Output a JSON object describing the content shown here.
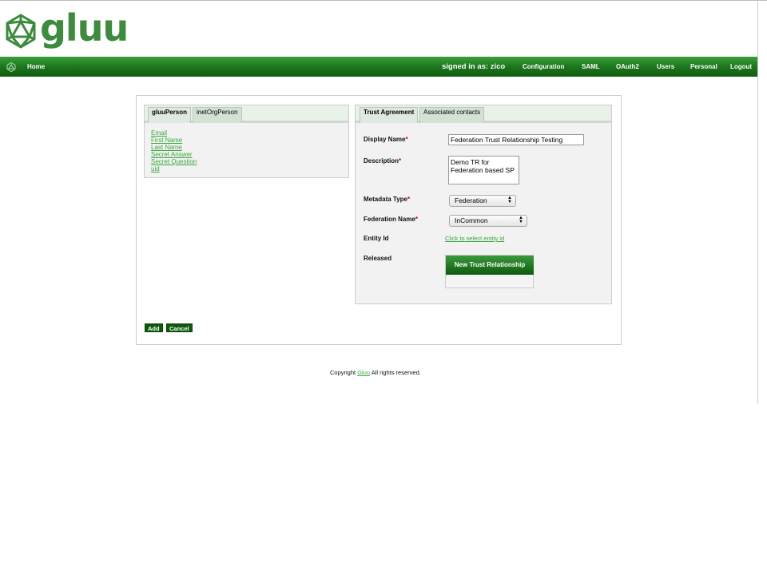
{
  "header": {
    "logo_text": "gluu"
  },
  "navbar": {
    "home": "Home",
    "signed_in": "signed in as: zico",
    "items": [
      "Configuration",
      "SAML",
      "OAuth2",
      "Users",
      "Personal",
      "Logout"
    ]
  },
  "left_panel": {
    "tabs": [
      "gluuPerson",
      "inetOrgPerson"
    ],
    "attributes": [
      "Email",
      "First Name",
      "Last Name",
      "Secret Answer",
      "Secret Question",
      "uid"
    ]
  },
  "right_panel": {
    "tabs": [
      "Trust Agreement",
      "Associated contacts"
    ],
    "display_name_label": "Display Name",
    "display_name_value": "Federation Trust Relationship Testing",
    "description_label": "Description",
    "description_value": "Demo TR for\nFederation based SP",
    "metadata_type_label": "Metadata Type",
    "metadata_type_value": "Federation",
    "federation_name_label": "Federation Name",
    "federation_name_value": "InCommon",
    "entity_id_label": "Entity Id",
    "entity_id_link": "Click to select entity id",
    "released_label": "Released",
    "new_trust_button": "New Trust Relationship",
    "required_mark": "*"
  },
  "actions": {
    "add": "Add",
    "cancel": "Cancel"
  },
  "footer": {
    "copyright": "Copyright",
    "link": "Gluu",
    "rights": "All rights reserved."
  },
  "colors": {
    "brand_green": "#3d8b3d",
    "nav_dark": "#0f5c0f",
    "link_green": "#3aa83a"
  }
}
